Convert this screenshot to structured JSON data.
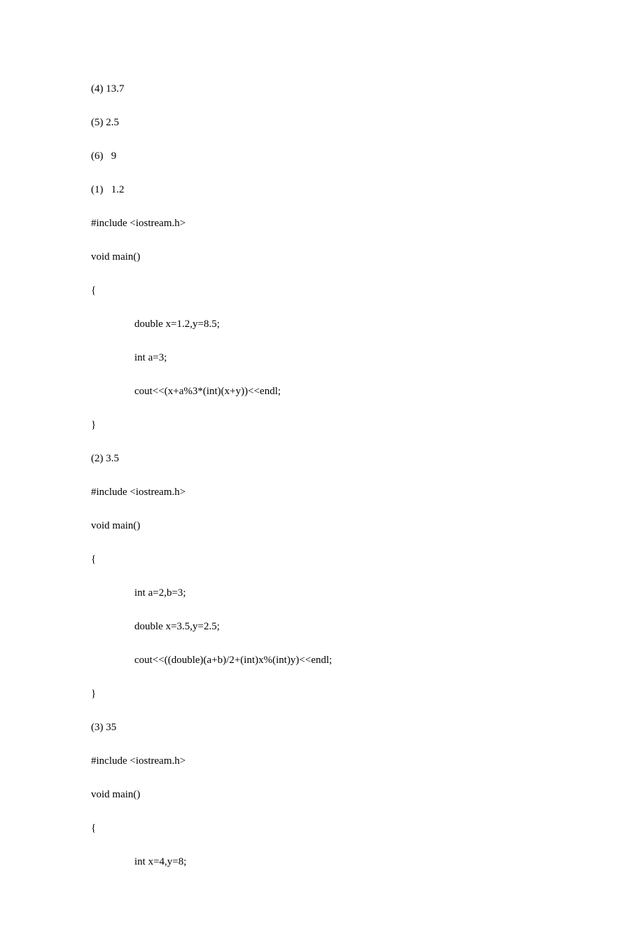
{
  "lines": [
    {
      "text": "(4) 13.7",
      "indent": false
    },
    {
      "text": "(5) 2.5",
      "indent": false
    },
    {
      "text": "(6)   9",
      "indent": false
    },
    {
      "text": "(1)   1.2",
      "indent": false
    },
    {
      "text": "#include <iostream.h>",
      "indent": false
    },
    {
      "text": "void main()",
      "indent": false
    },
    {
      "text": "{",
      "indent": false
    },
    {
      "text": "double x=1.2,y=8.5;",
      "indent": true
    },
    {
      "text": "int a=3;",
      "indent": true
    },
    {
      "text": "cout<<(x+a%3*(int)(x+y))<<endl;",
      "indent": true
    },
    {
      "text": "}",
      "indent": false
    },
    {
      "text": "(2) 3.5",
      "indent": false
    },
    {
      "text": "#include <iostream.h>",
      "indent": false
    },
    {
      "text": "void main()",
      "indent": false
    },
    {
      "text": "{",
      "indent": false
    },
    {
      "text": "int a=2,b=3;",
      "indent": true
    },
    {
      "text": "double x=3.5,y=2.5;",
      "indent": true
    },
    {
      "text": "cout<<((double)(a+b)/2+(int)x%(int)y)<<endl;",
      "indent": true
    },
    {
      "text": "}",
      "indent": false
    },
    {
      "text": "(3) 35",
      "indent": false
    },
    {
      "text": "#include <iostream.h>",
      "indent": false
    },
    {
      "text": "void main()",
      "indent": false
    },
    {
      "text": "{",
      "indent": false
    },
    {
      "text": "int x=4,y=8;",
      "indent": true
    }
  ]
}
